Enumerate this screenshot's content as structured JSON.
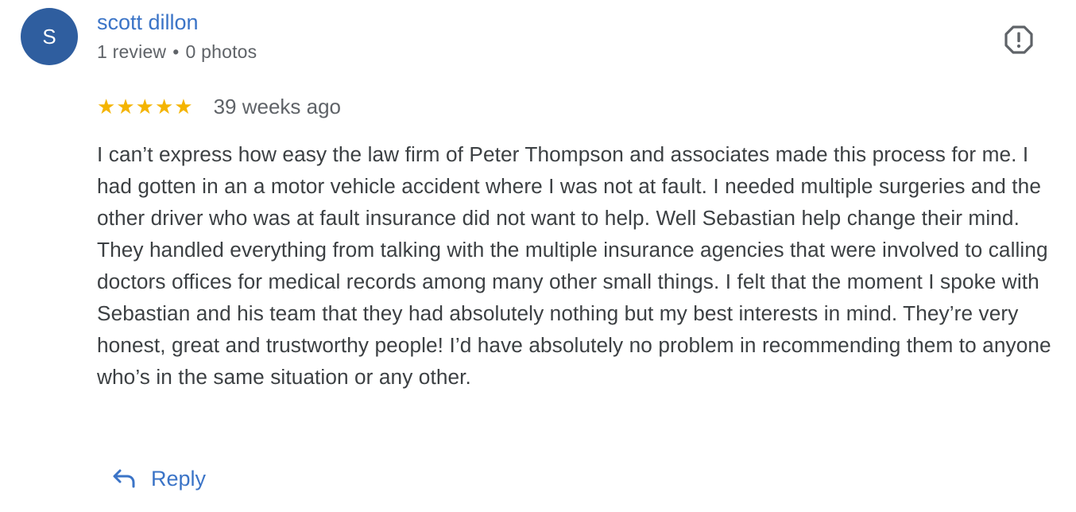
{
  "reviewer": {
    "avatar_letter": "S",
    "avatar_color": "#2f5e9f",
    "name": "scott dillon",
    "reviews_count": "1 review",
    "separator": "•",
    "photos_count": "0 photos"
  },
  "review": {
    "rating": 5,
    "rating_max": 5,
    "star_color": "#f4b400",
    "date": "39 weeks ago",
    "text": "I can’t express how easy the law firm of Peter Thompson and associates made this process for me. I had gotten in an a motor vehicle accident where I was not at fault. I needed multiple surgeries and the other driver who was at fault insurance did not want to help. Well Sebastian help change their mind. They handled everything from talking with the multiple insurance agencies that were involved to calling doctors offices for medical records among many other small things. I felt that the moment I spoke with Sebastian and his team that they had absolutely nothing but my best interests in mind. They’re very honest, great and trustworthy people! I’d have absolutely no problem in recommending them to anyone who’s in the same situation or any other."
  },
  "actions": {
    "reply_label": "Reply",
    "reply_icon": "reply-arrow-icon",
    "report_icon": "report-flag-icon",
    "accent_color": "#3b74c7"
  }
}
